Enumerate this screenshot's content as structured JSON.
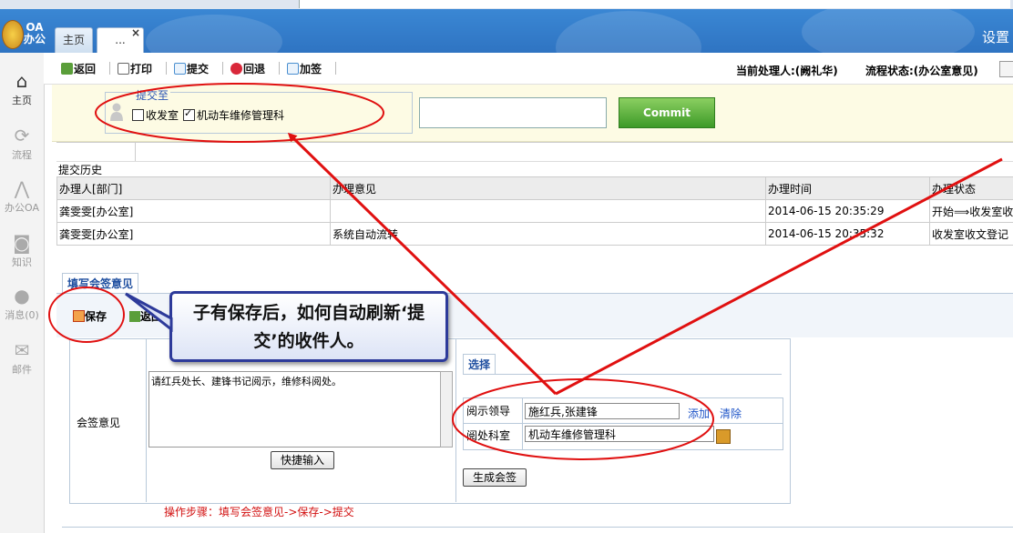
{
  "header": {
    "logo_text_1": "OA",
    "logo_text_2": "办公",
    "tabs": [
      {
        "label": "主页"
      },
      {
        "label": "..."
      }
    ],
    "tab_close": "×",
    "settings_label": "设置"
  },
  "sidebar": {
    "items": [
      {
        "label": "主页",
        "icon": "home-icon"
      },
      {
        "label": "流程",
        "icon": "workflow-icon"
      },
      {
        "label": "办公OA",
        "icon": "office-icon"
      },
      {
        "label": "知识",
        "icon": "knowledge-icon"
      },
      {
        "label": "消息(0)",
        "icon": "message-icon"
      },
      {
        "label": "邮件",
        "icon": "mail-icon"
      }
    ]
  },
  "toolbar": {
    "back": "返回",
    "print": "打印",
    "submit": "提交",
    "rollback": "回退",
    "countersign": "加签",
    "current_handler": "当前处理人:(阙礼华)",
    "process_status": "流程状态:(办公室意见)"
  },
  "submit_area": {
    "legend": "提交至",
    "options": [
      {
        "label": "收发室",
        "checked": false
      },
      {
        "label": "机动车维修管理科",
        "checked": true
      }
    ],
    "commit_label": "Commit"
  },
  "history": {
    "title": "提交历史",
    "columns": [
      "办理人[部门]",
      "办理意见",
      "办理时间",
      "办理状态"
    ],
    "rows": [
      [
        "龚雯雯[办公室]",
        "",
        "2014-06-15 20:35:29",
        "开始⟹收发室收"
      ],
      [
        "龚雯雯[办公室]",
        "系统自动流转",
        "2014-06-15 20:35:32",
        "收发室收文登记"
      ]
    ]
  },
  "form": {
    "tab_label": "填写会签意见",
    "save": "保存",
    "back": "返回",
    "opinion_label": "会签意见",
    "opinion_text": "请红兵处长、建锋书记阅示，维修科阅处。",
    "quick_input": "快捷输入",
    "select_tab": "选择",
    "leader_label": "阅示领导",
    "leader_value": "施红兵,张建锋",
    "add": "添加",
    "clear": "清除",
    "dept_label": "阅处科室",
    "dept_value": "机动车维修管理科",
    "generate": "生成会签",
    "steps": "操作步骤：填写会签意见->保存->提交"
  },
  "annotation": {
    "line1": "子有保存后，如何自动刷新‘提",
    "line2": "交’的收件人。"
  },
  "colors": {
    "header_blue": "#3a87d4",
    "commit_green": "#4caf32",
    "annotation_red": "#e01010",
    "link_blue": "#1f55c8"
  }
}
